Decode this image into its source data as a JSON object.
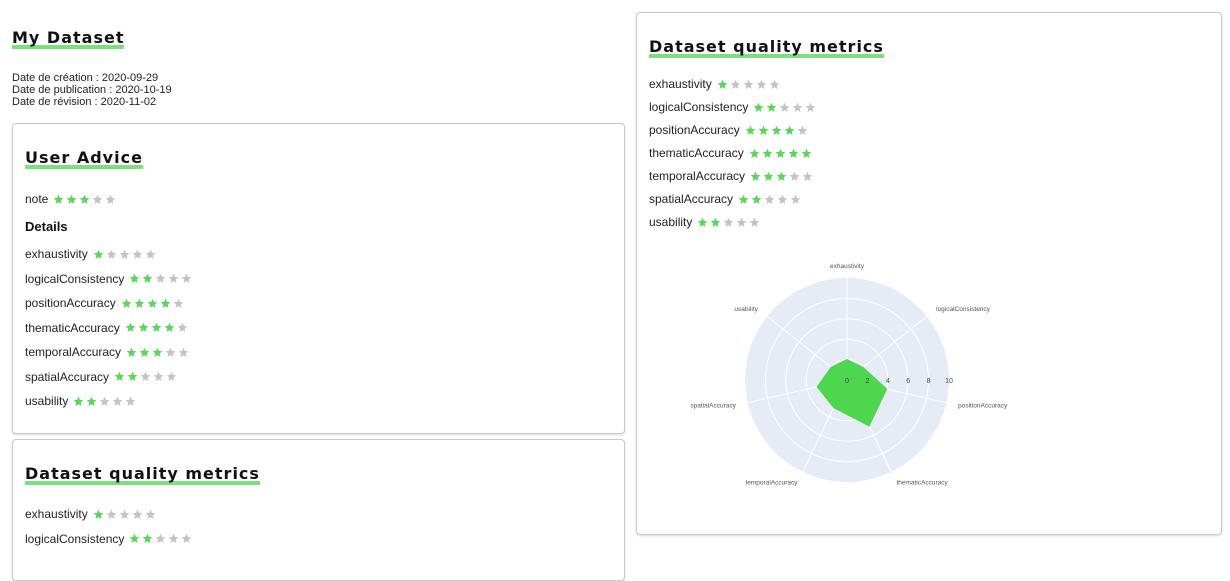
{
  "page": {
    "title": "My Dataset",
    "dates": [
      "Date de création : 2020-09-29",
      "Date de publication : 2020-10-19",
      "Date de révision : 2020-11-02"
    ]
  },
  "user_advice": {
    "title": "User Advice",
    "note": {
      "label": "note",
      "rating": 3,
      "max": 5
    },
    "details_heading": "Details",
    "details": [
      {
        "label": "exhaustivity",
        "rating": 1
      },
      {
        "label": "logicalConsistency",
        "rating": 2
      },
      {
        "label": "positionAccuracy",
        "rating": 4
      },
      {
        "label": "thematicAccuracy",
        "rating": 4
      },
      {
        "label": "temporalAccuracy",
        "rating": 3
      },
      {
        "label": "spatialAccuracy",
        "rating": 2
      },
      {
        "label": "usability",
        "rating": 2
      }
    ]
  },
  "quality_left": {
    "title": "Dataset quality metrics",
    "items": [
      {
        "label": "exhaustivity",
        "rating": 1
      },
      {
        "label": "logicalConsistency",
        "rating": 2
      }
    ]
  },
  "quality_right": {
    "title": "Dataset quality metrics",
    "items": [
      {
        "label": "exhaustivity",
        "rating": 1
      },
      {
        "label": "logicalConsistency",
        "rating": 2
      },
      {
        "label": "positionAccuracy",
        "rating": 4
      },
      {
        "label": "thematicAccuracy",
        "rating": 5
      },
      {
        "label": "temporalAccuracy",
        "rating": 3
      },
      {
        "label": "spatialAccuracy",
        "rating": 2
      },
      {
        "label": "usability",
        "rating": 2
      }
    ]
  },
  "colors": {
    "star_on": "#5bd65b",
    "star_off": "#c4c4c4",
    "radar_bg": "#e5ecf6",
    "radar_fill": "#4fd64f",
    "title_underline": "#7be07b"
  },
  "chart_data": {
    "type": "radar",
    "axes": [
      "exhaustivity",
      "logicalConsistency",
      "positionAccuracy",
      "thematicAccuracy",
      "temporalAccuracy",
      "spatialAccuracy",
      "usability"
    ],
    "values": [
      2,
      2,
      4,
      5,
      3,
      3,
      2
    ],
    "radial_ticks": [
      "0",
      "2",
      "4",
      "6",
      "8",
      "10"
    ],
    "range": [
      0,
      10
    ]
  }
}
